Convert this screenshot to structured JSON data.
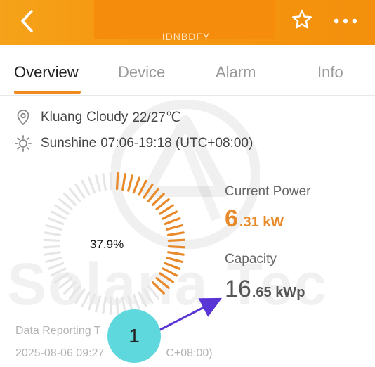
{
  "header": {
    "title_fragment": "IDNBDFY",
    "back_icon": "chevron-left-icon",
    "favorite_icon": "star-outline-icon",
    "more_icon": "more-horizontal-icon",
    "colors": {
      "gradient_start": "#f5a31a",
      "gradient_end": "#f38f0c"
    }
  },
  "tabs": [
    {
      "label": "Overview",
      "active": true
    },
    {
      "label": "Device",
      "active": false
    },
    {
      "label": "Alarm",
      "active": false
    },
    {
      "label": "Info",
      "active": false
    }
  ],
  "weather": {
    "location": "Kluang",
    "condition": "Cloudy",
    "temperature": "22/27℃",
    "sunshine_label": "Sunshine",
    "sunshine_hours": "07:06-19:18 (UTC+08:00)"
  },
  "gauge": {
    "percent_label": "37.9%",
    "fraction": 0.379,
    "colors": {
      "active": "#e8892a",
      "inactive": "#e6e6e6"
    }
  },
  "current_power": {
    "label": "Current Power",
    "integer": "6",
    "decimal_unit": ".31 kW",
    "color": "#e8892a"
  },
  "capacity": {
    "label": "Capacity",
    "integer": "16",
    "decimal_unit": ".65 kWp"
  },
  "data_reporting": {
    "label": "Data Reporting T",
    "time": "2025-08-06 09:27",
    "time_tail": "C+08:00)"
  },
  "watermark": {
    "text": "Solana Tec"
  },
  "annotation": {
    "number": "1",
    "circle_color": "#5fd8dd",
    "arrow_color": "#5a35d6"
  }
}
